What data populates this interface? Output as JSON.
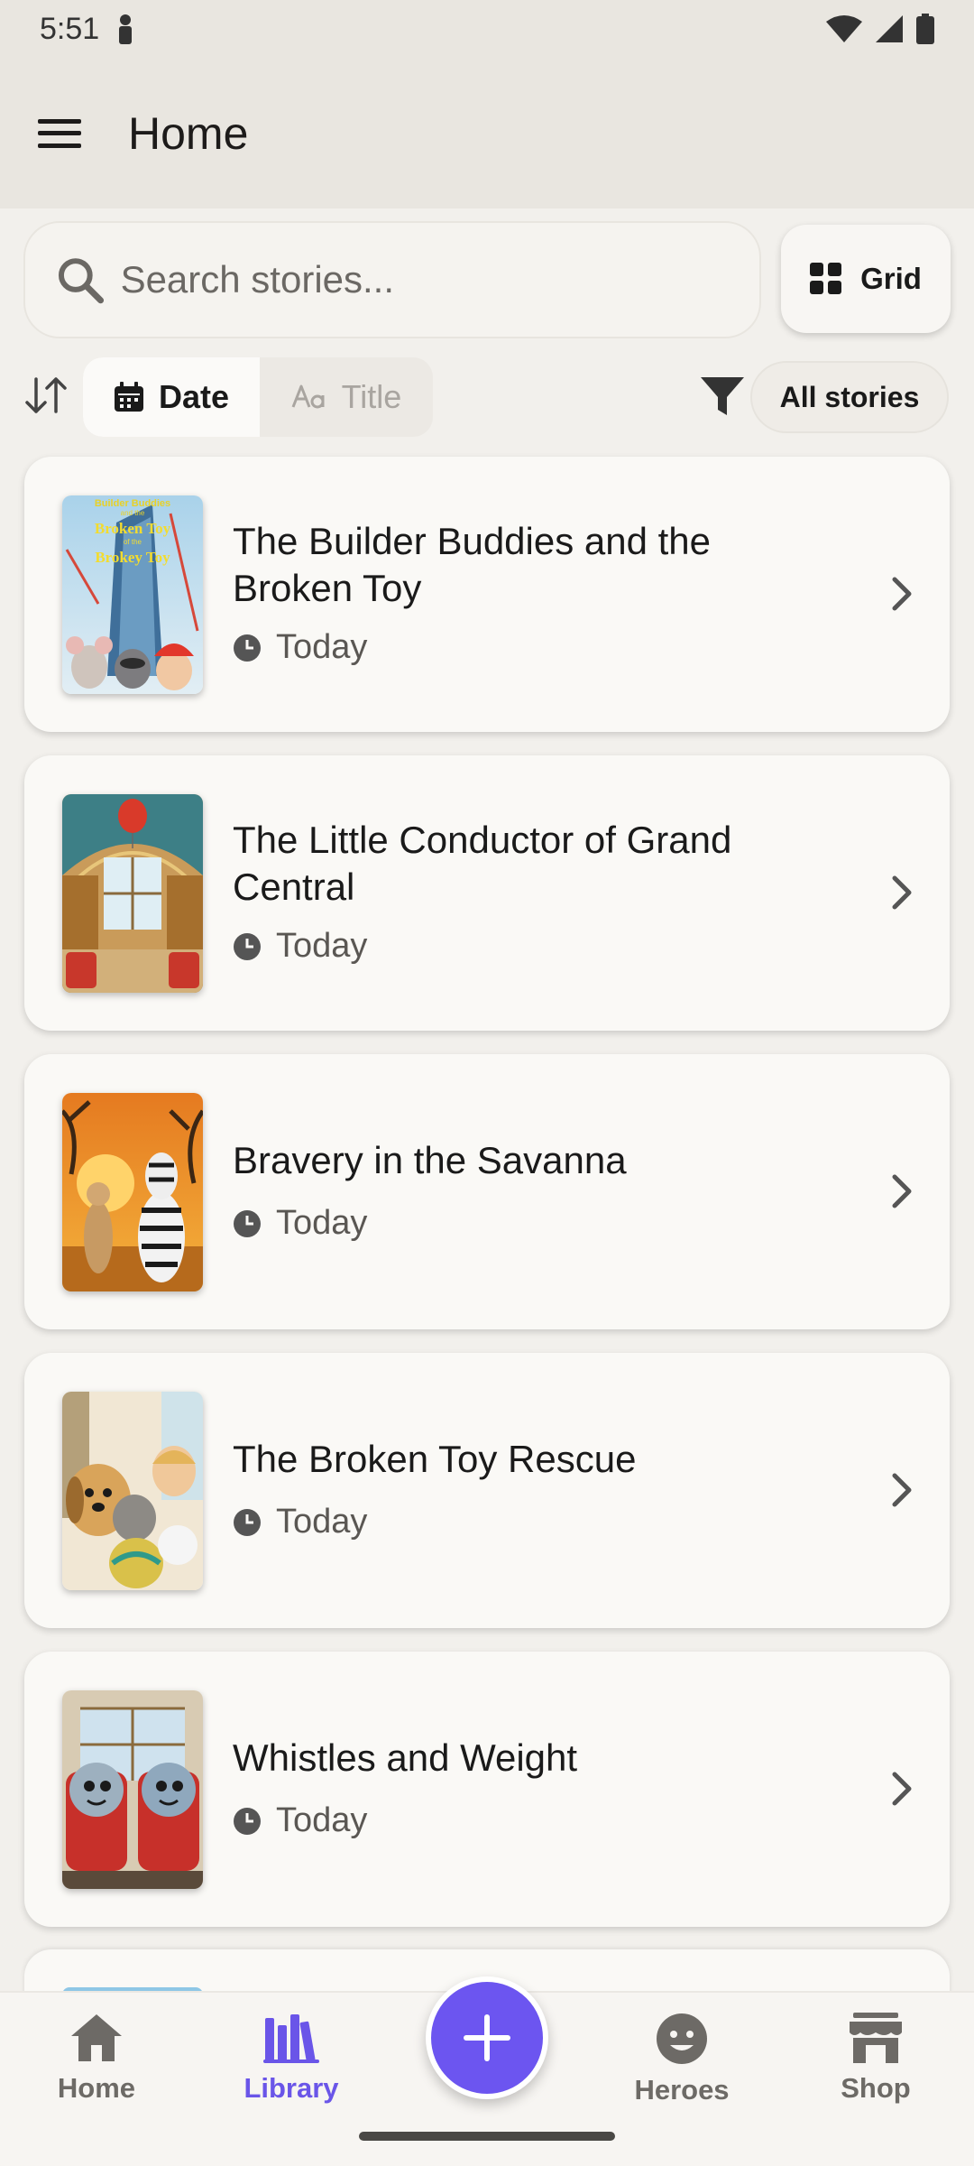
{
  "status_bar": {
    "time": "5:51"
  },
  "app_bar": {
    "title": "Home"
  },
  "search": {
    "placeholder": "Search stories..."
  },
  "view_toggle": {
    "label": "Grid"
  },
  "sort": {
    "options": [
      {
        "label": "Date",
        "active": true
      },
      {
        "label": "Title",
        "active": false
      }
    ]
  },
  "filter": {
    "label": "All stories"
  },
  "stories": [
    {
      "title": "The Builder Buddies and the Broken Toy",
      "date": "Today",
      "cover_text": [
        "Builder Buddies",
        "and the",
        "Broken Toy",
        "of the",
        "Brokey Toy"
      ]
    },
    {
      "title": "The Little Conductor of Grand Central",
      "date": "Today"
    },
    {
      "title": "Bravery in the Savanna",
      "date": "Today"
    },
    {
      "title": "The Broken Toy Rescue",
      "date": "Today"
    },
    {
      "title": "Whistles and Weight",
      "date": "Today"
    }
  ],
  "bottom_nav": {
    "items": [
      {
        "label": "Home",
        "icon": "home-icon"
      },
      {
        "label": "Library",
        "icon": "library-icon",
        "active": true
      },
      {
        "label": "Heroes",
        "icon": "heroes-icon"
      },
      {
        "label": "Shop",
        "icon": "shop-icon"
      }
    ]
  },
  "colors": {
    "accent": "#6c55f0",
    "active_nav": "#6a55e8"
  }
}
